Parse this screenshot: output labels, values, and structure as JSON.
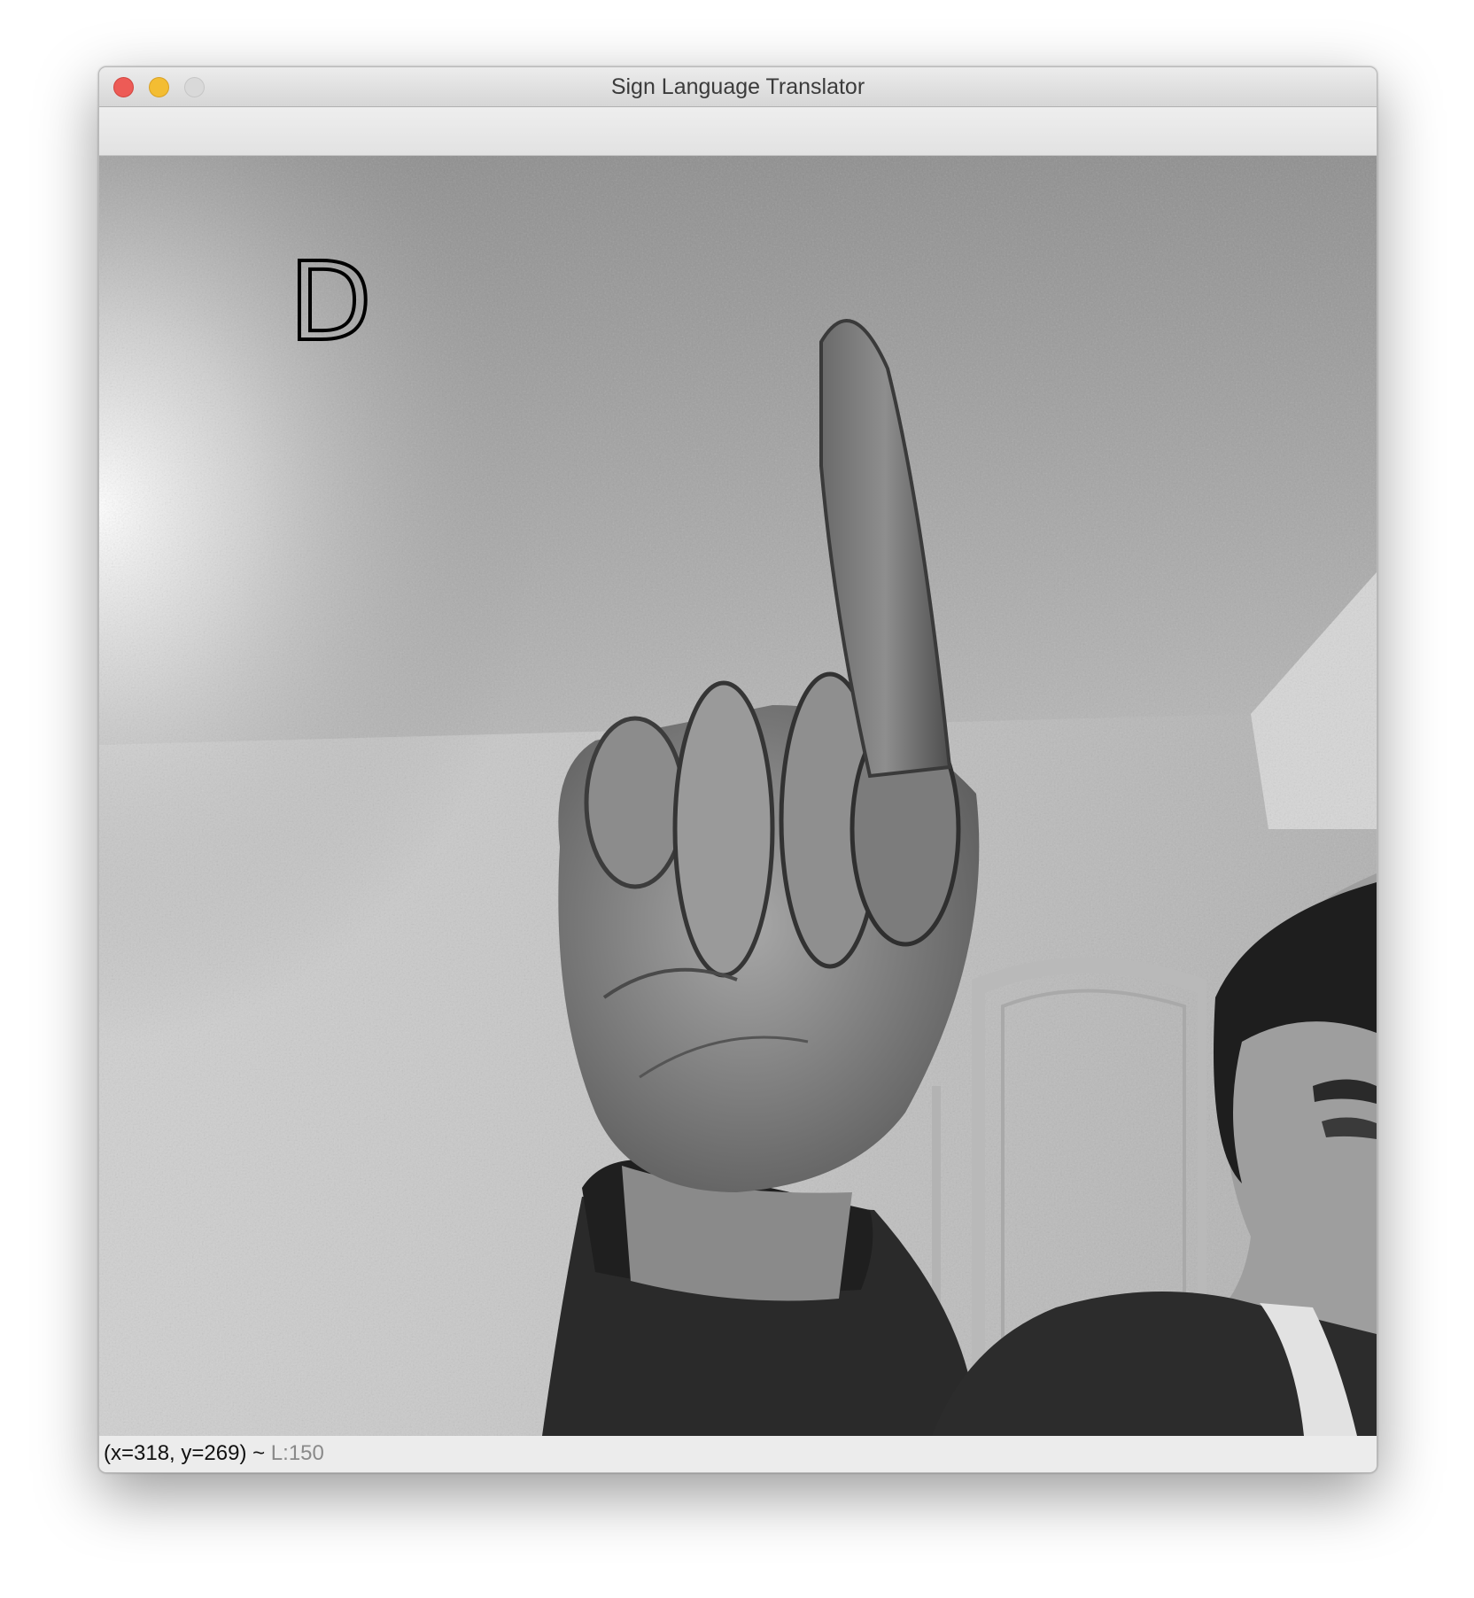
{
  "window": {
    "title": "Sign Language Translator"
  },
  "video": {
    "predicted_letter": "D",
    "mode": "grayscale"
  },
  "status": {
    "coordinates": "(x=318, y=269)",
    "separator": "~",
    "value": "L:150"
  },
  "icons": {
    "close": "close-icon",
    "minimize": "minimize-icon",
    "zoom": "zoom-icon"
  },
  "colors": {
    "close": "#ed5b56",
    "minimize": "#f3bd33",
    "zoom_disabled": "#d9d9d9"
  }
}
